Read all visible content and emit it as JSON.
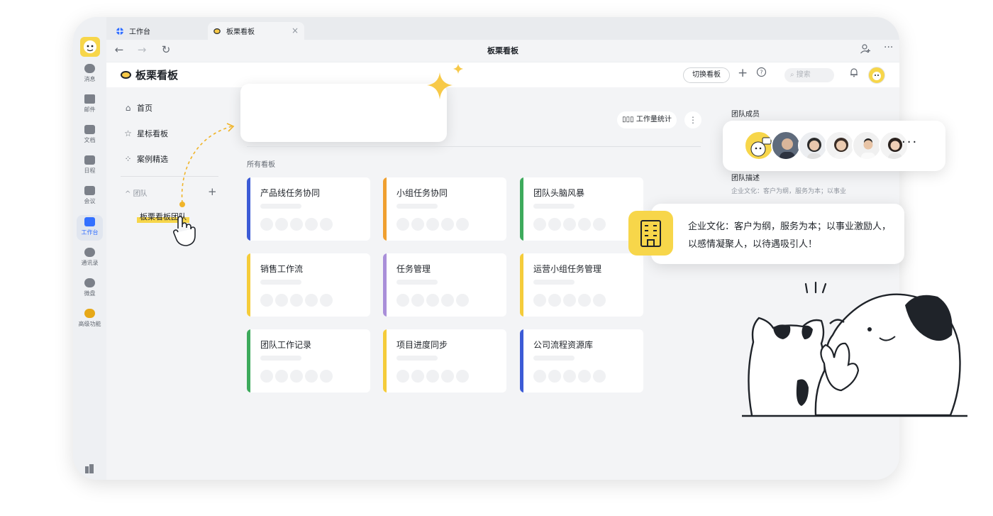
{
  "tabs": [
    {
      "label": "工作台",
      "icon": "workspace-icon"
    },
    {
      "label": "板栗看板",
      "icon": "board-logo-icon",
      "close": "×"
    }
  ],
  "window": {
    "title": "板栗看板"
  },
  "nav": {
    "back": "←",
    "forward": "→",
    "refresh": "↻",
    "add_member": "+",
    "more": "···"
  },
  "rail": [
    {
      "label": "消息",
      "icon": "message-icon"
    },
    {
      "label": "邮件",
      "icon": "mail-icon"
    },
    {
      "label": "文档",
      "icon": "docs-icon"
    },
    {
      "label": "日程",
      "icon": "calendar-icon"
    },
    {
      "label": "会议",
      "icon": "meeting-icon"
    },
    {
      "label": "工作台",
      "icon": "workspace-icon",
      "active": true
    },
    {
      "label": "通讯录",
      "icon": "contacts-icon"
    },
    {
      "label": "微盘",
      "icon": "drive-icon"
    },
    {
      "label": "高级功能",
      "icon": "premium-icon"
    }
  ],
  "app": {
    "name": "板栗看板",
    "switch_board": "切换看板",
    "add": "+",
    "help": "?",
    "search_placeholder": "搜索",
    "bell": "🔔"
  },
  "sidebar": {
    "home": "首页",
    "starred": "星标看板",
    "cases": "案例精选",
    "team_section": "团队",
    "team_add": "+",
    "team_item": "板栗看板团队"
  },
  "main": {
    "stats": "工作量统计",
    "more": "⋮",
    "section_title": "所有看板",
    "boards": [
      {
        "title": "产品线任务协同",
        "color": "#3c5bd6"
      },
      {
        "title": "小组任务协同",
        "color": "#f0a030"
      },
      {
        "title": "团队头脑风暴",
        "color": "#3daa5c"
      },
      {
        "title": "销售工作流",
        "color": "#f5cc3a"
      },
      {
        "title": "任务管理",
        "color": "#a98fd9"
      },
      {
        "title": "运营小组任务管理",
        "color": "#f5cc3a"
      },
      {
        "title": "团队工作记录",
        "color": "#3daa5c"
      },
      {
        "title": "项目进度同步",
        "color": "#f5cc3a"
      },
      {
        "title": "公司流程资源库",
        "color": "#3c5bd6"
      }
    ]
  },
  "right_panel": {
    "members_title": "团队成员",
    "desc_title": "团队描述",
    "desc_text": "企业文化：客户为纲，服务为本；以事业"
  },
  "members_card": {
    "more": "···"
  },
  "culture_card": {
    "text": "企业文化：客户为纲，服务为本；以事业激励人，以感情凝聚人，以待遇吸引人！"
  }
}
